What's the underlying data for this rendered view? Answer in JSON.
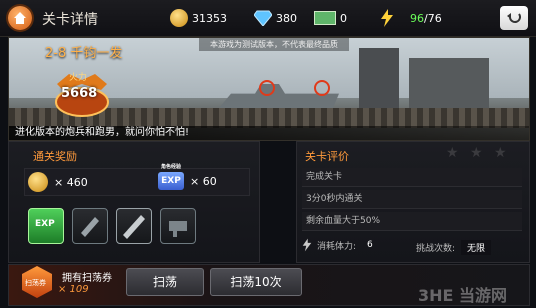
{
  "header": {
    "title": "关卡详情",
    "resources": {
      "gold": "31353",
      "diamond": "380",
      "cash": "0",
      "stamina": "96",
      "stamina_max": "/76"
    }
  },
  "banner": {
    "stage_name": "2-8 千钧一发",
    "notice": "本游戏为测试版本，不代表最终品质",
    "power_label": "火力",
    "power_value": "5668",
    "description": "进化版本的炮兵和跑男，就问你怕不怕!"
  },
  "rewards": {
    "title": "通关奖励",
    "gold": "× 460",
    "exp": "× 60",
    "exp_icon_top": "角色经验",
    "exp_icon_main": "EXP"
  },
  "evaluation": {
    "title": "关卡评价",
    "conditions": [
      "完成关卡",
      "3分0秒内通关",
      "剩余血量大于50%"
    ],
    "stamina_cost_label": "消耗体力:",
    "stamina_cost": "6",
    "challenge_label": "挑战次数:",
    "challenge_value": "无限"
  },
  "sweep": {
    "ticket_label": "拥有扫荡券",
    "ticket_count": "× 109",
    "ticket_icon_text": "扫荡券",
    "sweep_button": "扫荡",
    "sweep10_button": "扫荡10次"
  },
  "watermark": "当游网"
}
